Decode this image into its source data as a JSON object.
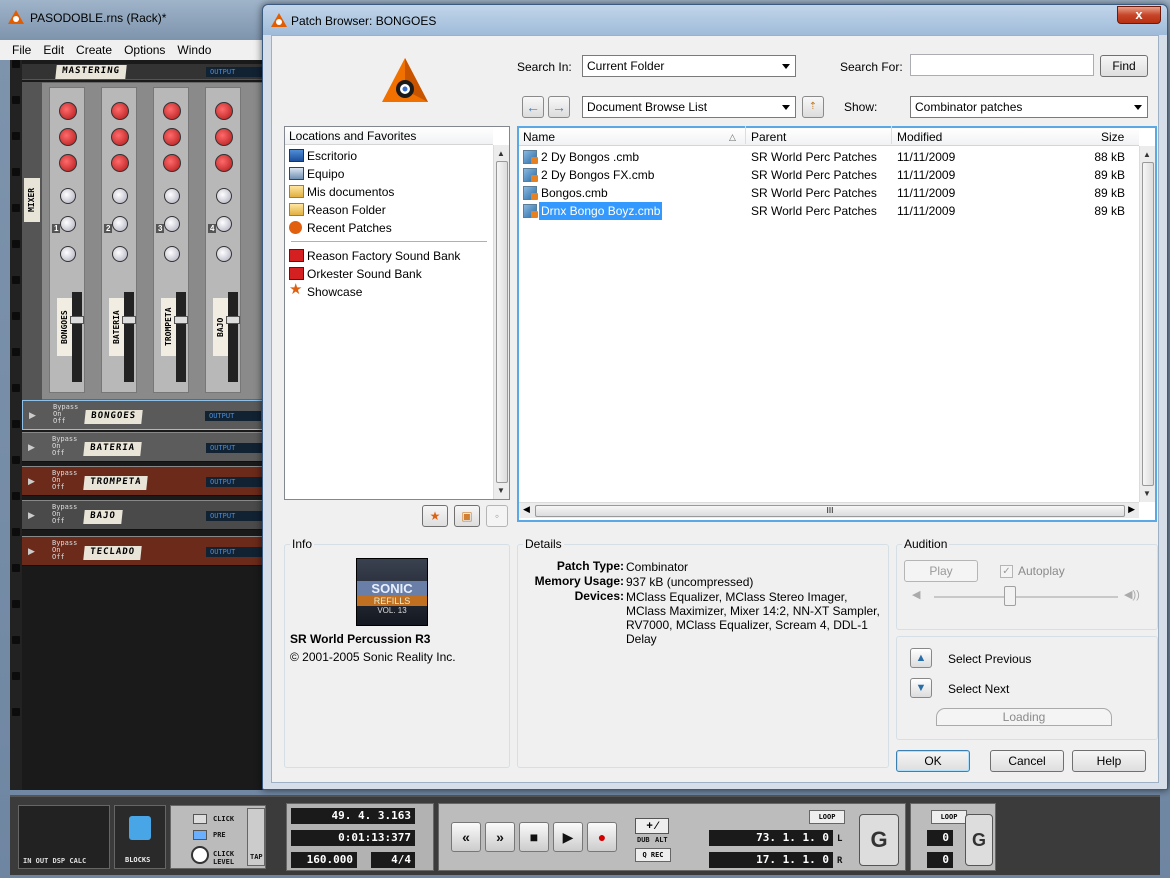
{
  "bg_window": {
    "title": "PASODOBLE.rns (Rack)*",
    "menu": [
      "File",
      "Edit",
      "Create",
      "Options",
      "Windo"
    ],
    "mastering_label": "MASTERING",
    "mixer_label": "MIXER",
    "channels": [
      {
        "num": "1",
        "name": "BONGOES"
      },
      {
        "num": "2",
        "name": "BATERIA"
      },
      {
        "num": "3",
        "name": "TROMPETA"
      },
      {
        "num": "4",
        "name": "BAJO"
      }
    ],
    "devices": [
      {
        "name": "BONGOES",
        "color": "#5a5a5a"
      },
      {
        "name": "BATERIA",
        "color": "#5c5c5c"
      },
      {
        "name": "TROMPETA",
        "color": "#6b2a1a"
      },
      {
        "name": "BAJO",
        "color": "#4a4a4a"
      },
      {
        "name": "TECLADO",
        "color": "#6b2a1a"
      }
    ],
    "bypass_text": "Bypass",
    "on_text": "On",
    "off_text": "Off",
    "output_text": "OUTPUT"
  },
  "transport": {
    "io_label": "IN  OUT  DSP CALC",
    "blocks_label": "BLOCKS",
    "click_label": "CLICK",
    "pre_label": "PRE",
    "click_level_label": "CLICK LEVEL",
    "tap_label": "TAP",
    "position": "49. 4. 3.163",
    "time": "0:01:13:377",
    "tempo": "160.000",
    "signature": "4/4",
    "dub_label": "DUB",
    "alt_label": "ALT",
    "qrec_label": "Q REC",
    "loop_label": "LOOP",
    "left_locator": "73. 1. 1.   0",
    "right_locator": "17. 1. 1.   0",
    "l_label": "L",
    "r_label": "R",
    "loop_label_2": "LOOP",
    "small_lcd_1": "0",
    "small_lcd_2": "0"
  },
  "dialog": {
    "title": "Patch Browser: BONGOES",
    "close": "x",
    "search_in_label": "Search In:",
    "search_in_value": "Current Folder",
    "search_for_label": "Search For:",
    "search_for_value": "",
    "find_button": "Find",
    "location_value": "Document Browse List",
    "show_label": "Show:",
    "show_value": "Combinator patches",
    "locations_header": "Locations and Favorites",
    "locations": [
      {
        "label": "Escritorio",
        "icon": "desktop-icon"
      },
      {
        "label": "Equipo",
        "icon": "computer-icon"
      },
      {
        "label": "Mis documentos",
        "icon": "folder-icon"
      },
      {
        "label": "Reason Folder",
        "icon": "folder-icon"
      },
      {
        "label": "Recent Patches",
        "icon": "recent-patches-icon"
      }
    ],
    "soundbanks": [
      {
        "label": "Reason Factory Sound Bank",
        "icon": "soundbank-icon"
      },
      {
        "label": "Orkester Sound Bank",
        "icon": "soundbank-icon"
      },
      {
        "label": "Showcase",
        "icon": "star-icon"
      }
    ],
    "columns": {
      "name": "Name",
      "parent": "Parent",
      "modified": "Modified",
      "size": "Size"
    },
    "files": [
      {
        "name": "2 Dy Bongos .cmb",
        "parent": "SR World Perc Patches",
        "modified": "11/11/2009",
        "size": "88 kB"
      },
      {
        "name": "2 Dy Bongos FX.cmb",
        "parent": "SR World Perc Patches",
        "modified": "11/11/2009",
        "size": "89 kB"
      },
      {
        "name": "Bongos.cmb",
        "parent": "SR World Perc Patches",
        "modified": "11/11/2009",
        "size": "89 kB"
      },
      {
        "name": "Drnx Bongo Boyz.cmb",
        "parent": "SR World Perc Patches",
        "modified": "11/11/2009",
        "size": "89 kB"
      }
    ],
    "hscroll_marker": "III",
    "info_label": "Info",
    "refill_badge": {
      "line1": "SONIC",
      "line2": "REFILLS",
      "line3": "VOL. 13"
    },
    "info_title": "SR World Percussion R3",
    "info_copyright": "© 2001-2005 Sonic Reality Inc.",
    "details_label": "Details",
    "patch_type_key": "Patch Type:",
    "patch_type_val": "Combinator",
    "memory_key": "Memory Usage:",
    "memory_val": "937 kB (uncompressed)",
    "devices_key": "Devices:",
    "devices_lines": [
      "MClass Equalizer, MClass Stereo Imager,",
      "MClass Maximizer, Mixer 14:2, NN-XT Sampler,",
      "RV7000, MClass Equalizer, Scream 4, DDL-1",
      "Delay"
    ],
    "audition_label": "Audition",
    "play_button": "Play",
    "autoplay_label": "Autoplay",
    "select_previous": "Select Previous",
    "select_next": "Select Next",
    "loading_label": "Loading",
    "ok_button": "OK",
    "cancel_button": "Cancel",
    "help_button": "Help"
  }
}
